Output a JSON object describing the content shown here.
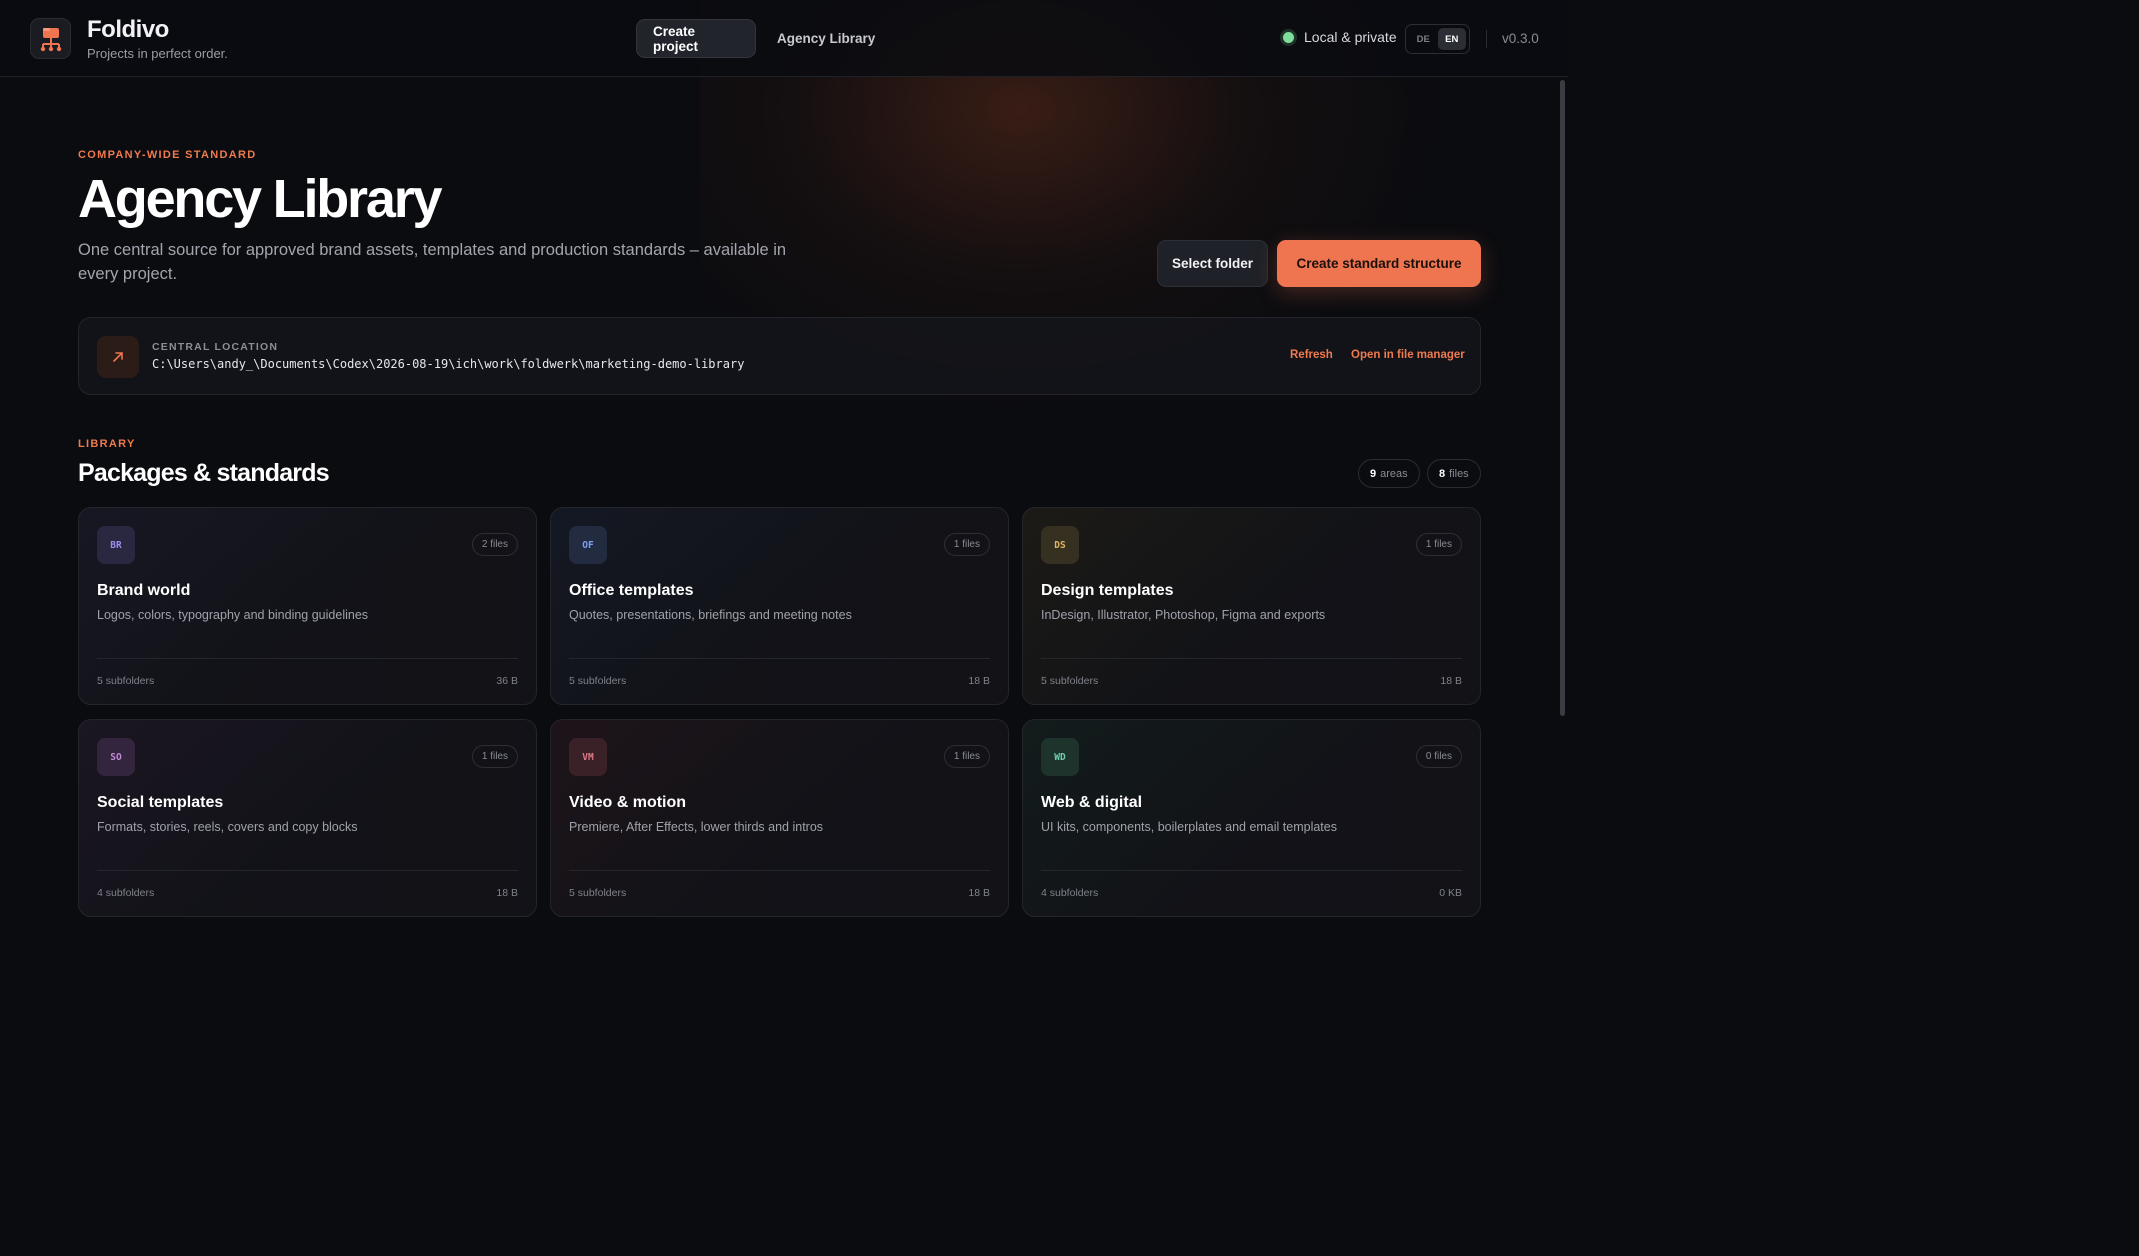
{
  "app": {
    "name": "Foldivo",
    "tagline": "Projects in perfect order.",
    "version": "v0.3.0"
  },
  "nav": {
    "create_project": "Create project",
    "agency_library": "Agency Library"
  },
  "status": {
    "label": "Local & private",
    "color": "#7ddf9b"
  },
  "language": {
    "options": [
      "DE",
      "EN"
    ],
    "selected": "EN"
  },
  "hero": {
    "eyebrow": "COMPANY-WIDE STANDARD",
    "title": "Agency Library",
    "subtitle": "One central source for approved brand assets, templates and production standards – available in every project.",
    "select_folder": "Select folder",
    "create_structure": "Create standard structure"
  },
  "location": {
    "icon": "arrow-up-right-icon",
    "label": "CENTRAL LOCATION",
    "path": "C:\\Users\\andy_\\Documents\\Codex\\2026-08-19\\ich\\work\\foldwerk\\marketing-demo-library",
    "refresh": "Refresh",
    "open_fm": "Open in file manager"
  },
  "library": {
    "eyebrow": "LIBRARY",
    "title": "Packages & standards",
    "areas_count": "9",
    "areas_label": "areas",
    "files_count": "8",
    "files_label": "files",
    "cards": [
      {
        "code": "BR",
        "files": "2 files",
        "title": "Brand world",
        "desc": "Logos, colors, typography and binding guidelines",
        "subfolders": "5 subfolders",
        "size": "36 B",
        "color": "#9a8cf0",
        "bg": "#2a2840"
      },
      {
        "code": "OF",
        "files": "1 files",
        "title": "Office templates",
        "desc": "Quotes, presentations, briefings and meeting notes",
        "subfolders": "5 subfolders",
        "size": "18 B",
        "color": "#7aa2f2",
        "bg": "#232b40"
      },
      {
        "code": "DS",
        "files": "1 files",
        "title": "Design templates",
        "desc": "InDesign, Illustrator, Photoshop, Figma and exports",
        "subfolders": "5 subfolders",
        "size": "18 B",
        "color": "#e0b766",
        "bg": "#363020"
      },
      {
        "code": "SO",
        "files": "1 files",
        "title": "Social templates",
        "desc": "Formats, stories, reels, covers and copy blocks",
        "subfolders": "4 subfolders",
        "size": "18 B",
        "color": "#c58ad9",
        "bg": "#33253d"
      },
      {
        "code": "VM",
        "files": "1 files",
        "title": "Video & motion",
        "desc": "Premiere, After Effects, lower thirds and intros",
        "subfolders": "5 subfolders",
        "size": "18 B",
        "color": "#e07a8a",
        "bg": "#3a2128"
      },
      {
        "code": "WD",
        "files": "0 files",
        "title": "Web & digital",
        "desc": "UI kits, components, boilerplates and email templates",
        "subfolders": "4 subfolders",
        "size": "0 KB",
        "color": "#6fcfae",
        "bg": "#1f332d"
      }
    ]
  },
  "colors": {
    "accent": "#ee7550",
    "background": "#0b0c10"
  }
}
